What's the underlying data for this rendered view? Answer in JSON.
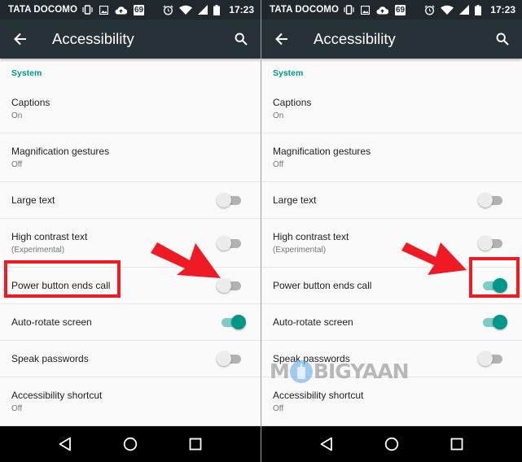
{
  "colors": {
    "statusbar_bg": "#20282e",
    "appbar_bg": "#263238",
    "accent": "#009688",
    "accent_light": "#80cbc4",
    "highlight": "#ee1b24",
    "navbar_bg": "#000000"
  },
  "panels": [
    {
      "id": "before",
      "statusbar": {
        "carrier": "TATA DOCOMO",
        "left_icons": [
          "vibrate-icon",
          "image-icon",
          "cloud-upload-icon",
          "notification-69-badge"
        ],
        "badge_text": "69",
        "right_icons": [
          "alarm-icon",
          "wifi-icon",
          "signal-icon",
          "battery-icon"
        ],
        "time": "17:23"
      },
      "appbar": {
        "title": "Accessibility",
        "back_icon": "arrow-back-icon",
        "search_icon": "search-icon"
      },
      "section": "System",
      "items": [
        {
          "label": "Captions",
          "summary": "On"
        },
        {
          "label": "Magnification gestures",
          "summary": "Off"
        },
        {
          "label": "Large text",
          "toggle": false
        },
        {
          "label": "High contrast text",
          "summary": "(Experimental)",
          "toggle": false
        },
        {
          "label": "Power button ends call",
          "toggle": false,
          "highlighted": "label"
        },
        {
          "label": "Auto-rotate screen",
          "toggle": true
        },
        {
          "label": "Speak passwords",
          "toggle": false
        },
        {
          "label": "Accessibility shortcut",
          "summary": "Off"
        }
      ],
      "navbar": [
        "back-nav-icon",
        "home-nav-icon",
        "recents-nav-icon"
      ]
    },
    {
      "id": "after",
      "statusbar": {
        "carrier": "TATA DOCOMO",
        "left_icons": [
          "vibrate-icon",
          "image-icon",
          "cloud-upload-icon",
          "notification-69-badge"
        ],
        "badge_text": "69",
        "right_icons": [
          "alarm-icon",
          "wifi-icon",
          "signal-icon",
          "battery-icon"
        ],
        "time": "17:23"
      },
      "appbar": {
        "title": "Accessibility",
        "back_icon": "arrow-back-icon",
        "search_icon": "search-icon"
      },
      "section": "System",
      "items": [
        {
          "label": "Captions",
          "summary": "On"
        },
        {
          "label": "Magnification gestures",
          "summary": "Off"
        },
        {
          "label": "Large text",
          "toggle": false
        },
        {
          "label": "High contrast text",
          "summary": "(Experimental)",
          "toggle": false
        },
        {
          "label": "Power button ends call",
          "toggle": true,
          "highlighted": "toggle"
        },
        {
          "label": "Auto-rotate screen",
          "toggle": true
        },
        {
          "label": "Speak passwords",
          "toggle": false
        },
        {
          "label": "Accessibility shortcut",
          "summary": "Off"
        }
      ],
      "navbar": [
        "back-nav-icon",
        "home-nav-icon",
        "recents-nav-icon"
      ]
    }
  ],
  "watermark": {
    "text_left": "M",
    "text_right": "BIGYAAN"
  }
}
